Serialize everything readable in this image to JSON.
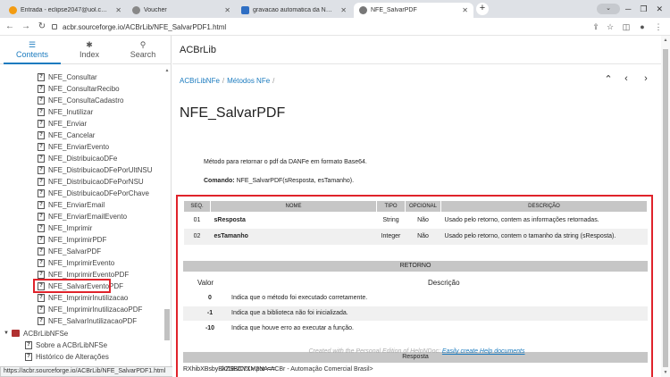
{
  "browser": {
    "tabs": [
      {
        "label": "Entrada - eclipse2047@uol.com.b",
        "favicon_color": "#f39c12"
      },
      {
        "label": "Voucher",
        "favicon_color": "#888888"
      },
      {
        "label": "gravacao automatica da NFE em",
        "favicon_color": "#2f6fc4"
      },
      {
        "label": "NFE_SalvarPDF",
        "favicon_color": "#777777"
      }
    ],
    "address": "acbr.sourceforge.io/ACBrLib/NFE_SalvarPDF1.html",
    "status_url": "https://acbr.sourceforge.io/ACBrLib/NFE_SalvarPDF1.html"
  },
  "sidebar": {
    "tabs": [
      {
        "label": "Contents",
        "icon": "list-icon"
      },
      {
        "label": "Index",
        "icon": "asterisk-icon"
      },
      {
        "label": "Search",
        "icon": "search-icon"
      }
    ],
    "items": [
      "NFE_Consultar",
      "NFE_ConsultarRecibo",
      "NFE_ConsultaCadastro",
      "NFE_Inutilizar",
      "NFE_Enviar",
      "NFE_Cancelar",
      "NFE_EnviarEvento",
      "NFE_DistribuicaoDFe",
      "NFE_DistribuicaoDFePorUltNSU",
      "NFE_DistribuicaoDFePorNSU",
      "NFE_DistribuicaoDFePorChave",
      "NFE_EnviarEmail",
      "NFE_EnviarEmailEvento",
      "NFE_Imprimir",
      "NFE_ImprimirPDF",
      "NFE_SalvarPDF",
      "NFE_ImprimirEvento",
      "NFE_ImprimirEventoPDF",
      "NFE_SalvarEventoPDF",
      "NFE_ImprimirInutilizacao",
      "NFE_ImprimirInutilizacaoPDF",
      "NFE_SalvarInutilizacaoPDF"
    ],
    "section": "ACBrLibNFSe",
    "section_items": [
      "Sobre a ACBrLibNFSe",
      "Histórico de Alterações"
    ],
    "selected": "NFE_SalvarPDF",
    "highlight_color": "#e0232b"
  },
  "main": {
    "header_title": "ACBrLib",
    "breadcrumb": [
      "ACBrLibNFe",
      "Métodos NFe"
    ],
    "page_title": "NFE_SalvarPDF",
    "description": "Método para retornar o pdf da DANFe em formato Base64.",
    "command_label": "Comando:",
    "command_text": "NFE_SalvarPDF(sResposta, esTamanho).",
    "params_headers": [
      "SEQ.",
      "NOME",
      "TIPO",
      "OPCIONAL",
      "DESCRIÇÃO"
    ],
    "params": [
      {
        "seq": "01",
        "nome": "sResposta",
        "tipo": "String",
        "opcional": "Não",
        "descricao": "Usado pelo retorno, contem as informações retornadas."
      },
      {
        "seq": "02",
        "nome": "esTamanho",
        "tipo": "Integer",
        "opcional": "Não",
        "descricao": "Usado pelo retorno, contem o tamanho da string (sResposta)."
      }
    ],
    "retorno_title": "RETORNO",
    "retorno_headers": {
      "valor": "Valor",
      "descricao": "Descrição"
    },
    "retorno": [
      {
        "valor": "0",
        "texto": "Indica que o método foi executado corretamente."
      },
      {
        "valor": "-1",
        "texto": "Indica que a biblioteca não foi inicializada."
      },
      {
        "valor": "-10",
        "texto": "Indica que houve erro ao executar a função."
      }
    ],
    "resposta_title": "Resposta",
    "resposta_value": "RXhibXBsbyBkZSBCYXM2NA==",
    "footer_text": "Created with the Personal Edition of HelpNDoc:",
    "footer_link": "Easily create Help documents",
    "copyright": "2018-2021> por <ACBr - Automação Comercial Brasil>"
  }
}
